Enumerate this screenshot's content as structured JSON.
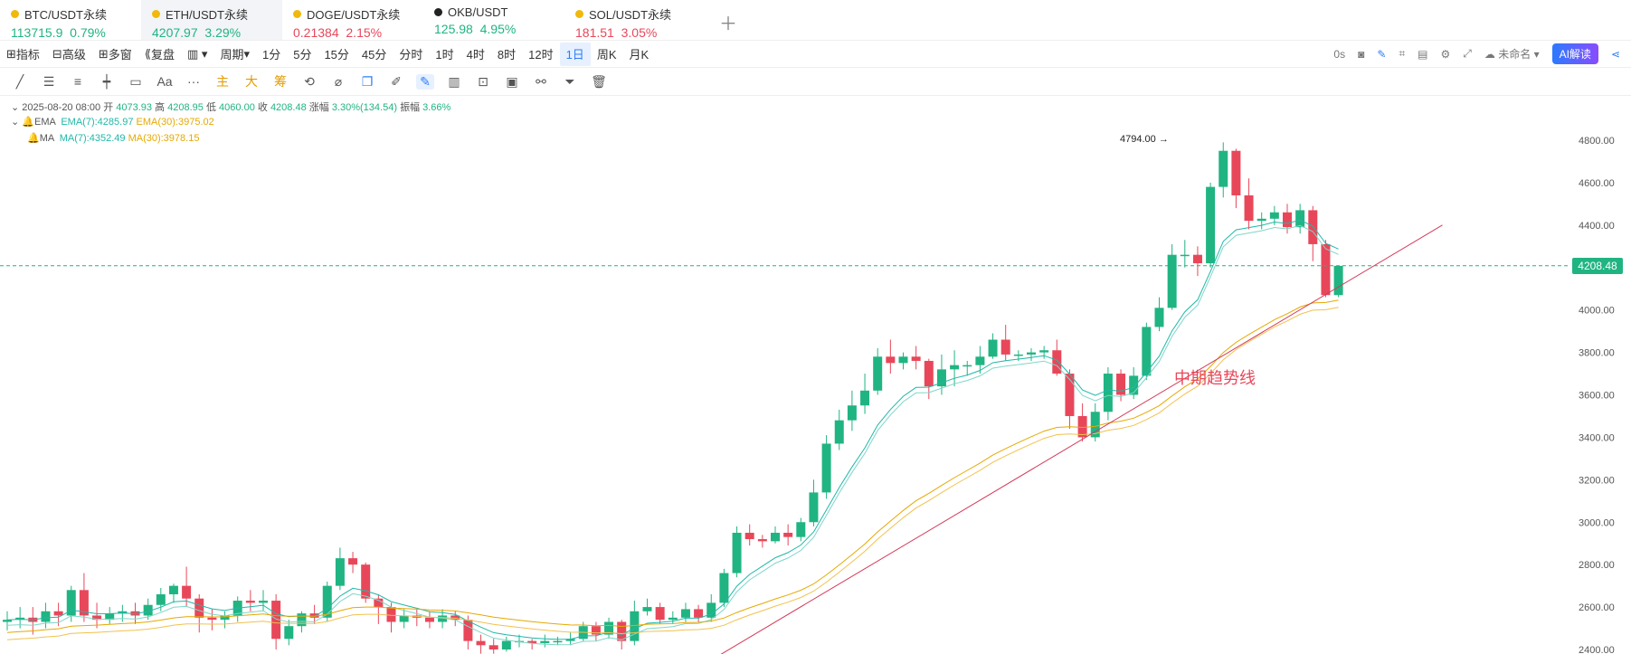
{
  "tabs": [
    {
      "symbol": "BTC/USDT永续",
      "price": "113715.9",
      "change": "0.79%",
      "dir": "up",
      "icon": "binance-icon"
    },
    {
      "symbol": "ETH/USDT永续",
      "price": "4207.97",
      "change": "3.29%",
      "dir": "up",
      "icon": "binance-icon",
      "active": true
    },
    {
      "symbol": "DOGE/USDT永续",
      "price": "0.21384",
      "change": "2.15%",
      "dir": "dn",
      "icon": "binance-icon"
    },
    {
      "symbol": "OKB/USDT",
      "price": "125.98",
      "change": "4.95%",
      "dir": "up",
      "icon": "okx-icon"
    },
    {
      "symbol": "SOL/USDT永续",
      "price": "181.51",
      "change": "3.05%",
      "dir": "dn",
      "icon": "binance-icon"
    }
  ],
  "toolbar": {
    "items": [
      "指标",
      "高级",
      "多窗",
      "复盘",
      "",
      "周期",
      "1分",
      "5分",
      "15分",
      "45分",
      "分时",
      "1时",
      "4时",
      "8时",
      "12时",
      "1日",
      "周K",
      "月K"
    ],
    "selected": "1日",
    "right_timer": "0s",
    "account": "未命名",
    "ai_label": "AI解读"
  },
  "drawtools": [
    "主",
    "大",
    "筹"
  ],
  "legend": {
    "date": "2025-08-20 08:00",
    "open_label": "开",
    "open": "4073.93",
    "high_label": "高",
    "high": "4208.95",
    "low_label": "低",
    "low": "4060.00",
    "close_label": "收",
    "close": "4208.48",
    "chg_label": "涨幅",
    "chg": "3.30%(134.54)",
    "amp_label": "振幅",
    "amp": "3.66%",
    "ema_name": "EMA",
    "ema7": "EMA(7):4285.97",
    "ema30": "EMA(30):3975.02",
    "ma_name": "MA",
    "ma7": "MA(7):4352.49",
    "ma30": "MA(30):3978.15"
  },
  "annotations": {
    "high_marker": "4794.00",
    "trend_label": "中期趋势线",
    "last_price": "4208.48"
  },
  "colors": {
    "up": "#20b482",
    "down": "#e8475a",
    "ema7": "#1fb8a8",
    "ema30": "#e6a800",
    "trend": "#d33a5a"
  },
  "chart_data": {
    "type": "candlestick",
    "y_ticks": [
      4800,
      4600,
      4400,
      4200,
      4000,
      3800,
      3600,
      3400,
      3200,
      3000,
      2800,
      2600,
      2400
    ],
    "ylim": [
      2400,
      4850
    ],
    "candles": [
      [
        2530,
        2540,
        2490,
        2580
      ],
      [
        2540,
        2550,
        2500,
        2600
      ],
      [
        2550,
        2530,
        2470,
        2600
      ],
      [
        2530,
        2580,
        2500,
        2620
      ],
      [
        2580,
        2560,
        2510,
        2620
      ],
      [
        2560,
        2680,
        2530,
        2700
      ],
      [
        2680,
        2560,
        2530,
        2760
      ],
      [
        2560,
        2540,
        2500,
        2620
      ],
      [
        2540,
        2570,
        2520,
        2600
      ],
      [
        2570,
        2580,
        2530,
        2610
      ],
      [
        2580,
        2560,
        2520,
        2620
      ],
      [
        2560,
        2610,
        2540,
        2640
      ],
      [
        2610,
        2660,
        2580,
        2690
      ],
      [
        2660,
        2700,
        2620,
        2710
      ],
      [
        2700,
        2640,
        2600,
        2790
      ],
      [
        2640,
        2550,
        2480,
        2660
      ],
      [
        2550,
        2540,
        2490,
        2590
      ],
      [
        2540,
        2560,
        2500,
        2580
      ],
      [
        2560,
        2630,
        2530,
        2650
      ],
      [
        2630,
        2620,
        2580,
        2680
      ],
      [
        2620,
        2630,
        2580,
        2680
      ],
      [
        2630,
        2450,
        2400,
        2660
      ],
      [
        2450,
        2510,
        2420,
        2540
      ],
      [
        2510,
        2570,
        2480,
        2580
      ],
      [
        2570,
        2550,
        2520,
        2610
      ],
      [
        2550,
        2700,
        2530,
        2720
      ],
      [
        2700,
        2830,
        2680,
        2880
      ],
      [
        2830,
        2800,
        2760,
        2860
      ],
      [
        2800,
        2640,
        2620,
        2810
      ],
      [
        2640,
        2600,
        2520,
        2660
      ],
      [
        2600,
        2530,
        2480,
        2620
      ],
      [
        2530,
        2560,
        2500,
        2590
      ],
      [
        2560,
        2550,
        2510,
        2590
      ],
      [
        2550,
        2530,
        2500,
        2580
      ],
      [
        2530,
        2560,
        2500,
        2590
      ],
      [
        2560,
        2540,
        2510,
        2580
      ],
      [
        2540,
        2440,
        2400,
        2560
      ],
      [
        2440,
        2420,
        2380,
        2470
      ],
      [
        2420,
        2400,
        2380,
        2450
      ],
      [
        2400,
        2440,
        2390,
        2460
      ],
      [
        2440,
        2440,
        2410,
        2470
      ],
      [
        2440,
        2430,
        2400,
        2450
      ],
      [
        2430,
        2440,
        2410,
        2470
      ],
      [
        2440,
        2440,
        2420,
        2460
      ],
      [
        2440,
        2450,
        2420,
        2480
      ],
      [
        2450,
        2510,
        2440,
        2530
      ],
      [
        2510,
        2470,
        2440,
        2530
      ],
      [
        2470,
        2530,
        2450,
        2550
      ],
      [
        2530,
        2440,
        2400,
        2540
      ],
      [
        2440,
        2580,
        2420,
        2630
      ],
      [
        2580,
        2600,
        2560,
        2640
      ],
      [
        2600,
        2540,
        2520,
        2620
      ],
      [
        2540,
        2550,
        2520,
        2580
      ],
      [
        2550,
        2590,
        2530,
        2620
      ],
      [
        2590,
        2550,
        2530,
        2610
      ],
      [
        2550,
        2620,
        2530,
        2660
      ],
      [
        2620,
        2760,
        2600,
        2780
      ],
      [
        2760,
        2950,
        2740,
        2980
      ],
      [
        2950,
        2920,
        2890,
        2990
      ],
      [
        2920,
        2910,
        2880,
        2940
      ],
      [
        2910,
        2950,
        2900,
        2980
      ],
      [
        2950,
        2930,
        2890,
        2990
      ],
      [
        2930,
        3000,
        2910,
        3020
      ],
      [
        3000,
        3140,
        2980,
        3200
      ],
      [
        3140,
        3370,
        3110,
        3410
      ],
      [
        3370,
        3480,
        3340,
        3530
      ],
      [
        3480,
        3550,
        3430,
        3620
      ],
      [
        3550,
        3620,
        3510,
        3700
      ],
      [
        3620,
        3780,
        3600,
        3820
      ],
      [
        3780,
        3750,
        3700,
        3860
      ],
      [
        3750,
        3780,
        3720,
        3800
      ],
      [
        3780,
        3760,
        3720,
        3830
      ],
      [
        3760,
        3640,
        3580,
        3770
      ],
      [
        3640,
        3720,
        3600,
        3790
      ],
      [
        3720,
        3740,
        3640,
        3810
      ],
      [
        3740,
        3740,
        3690,
        3760
      ],
      [
        3740,
        3780,
        3700,
        3830
      ],
      [
        3780,
        3860,
        3770,
        3890
      ],
      [
        3860,
        3790,
        3760,
        3930
      ],
      [
        3790,
        3790,
        3760,
        3810
      ],
      [
        3790,
        3800,
        3760,
        3820
      ],
      [
        3800,
        3810,
        3770,
        3830
      ],
      [
        3810,
        3700,
        3690,
        3860
      ],
      [
        3700,
        3500,
        3440,
        3720
      ],
      [
        3500,
        3400,
        3380,
        3560
      ],
      [
        3400,
        3520,
        3380,
        3560
      ],
      [
        3520,
        3700,
        3480,
        3730
      ],
      [
        3700,
        3600,
        3570,
        3720
      ],
      [
        3600,
        3690,
        3580,
        3730
      ],
      [
        3690,
        3920,
        3670,
        3940
      ],
      [
        3920,
        4010,
        3900,
        4060
      ],
      [
        4010,
        4260,
        4000,
        4310
      ],
      [
        4260,
        4260,
        4200,
        4330
      ],
      [
        4260,
        4220,
        4160,
        4300
      ],
      [
        4220,
        4580,
        4200,
        4600
      ],
      [
        4580,
        4750,
        4530,
        4790
      ],
      [
        4750,
        4540,
        4480,
        4760
      ],
      [
        4540,
        4420,
        4380,
        4620
      ],
      [
        4420,
        4430,
        4380,
        4460
      ],
      [
        4430,
        4460,
        4400,
        4490
      ],
      [
        4460,
        4390,
        4360,
        4500
      ],
      [
        4390,
        4470,
        4360,
        4500
      ],
      [
        4470,
        4310,
        4230,
        4490
      ],
      [
        4310,
        4070,
        4060,
        4330
      ],
      [
        4070,
        4208,
        4060,
        4209
      ]
    ],
    "trendline": [
      [
        2350,
        0
      ],
      [
        4400,
        110
      ]
    ],
    "ema7": [],
    "ema30": []
  }
}
